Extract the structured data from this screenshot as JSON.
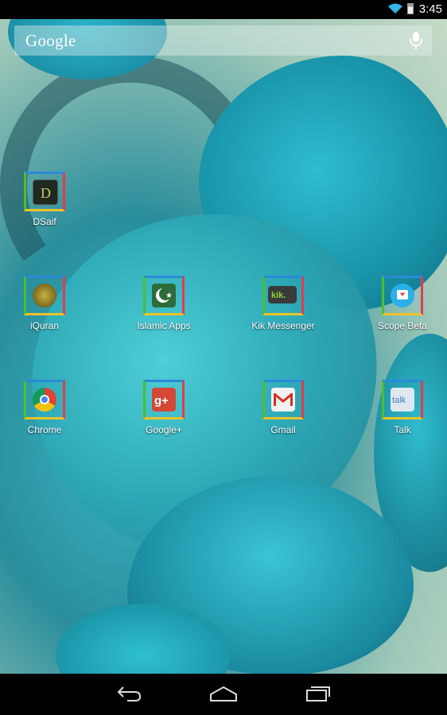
{
  "status_bar": {
    "time": "3:45",
    "icons": [
      "wifi-icon",
      "battery-icon"
    ]
  },
  "search": {
    "logo": "Google",
    "icon": "mic-icon"
  },
  "apps": [
    {
      "label": "DSaif",
      "icon": "dsaif-icon"
    },
    {
      "label": "iQuran",
      "icon": "iquran-icon"
    },
    {
      "label": "Islamic Apps",
      "icon": "islamic-apps-icon"
    },
    {
      "label": "Kik Messenger",
      "icon": "kik-icon"
    },
    {
      "label": "Scope Beta",
      "icon": "scope-icon"
    },
    {
      "label": "Chrome",
      "icon": "chrome-icon"
    },
    {
      "label": "Google+",
      "icon": "google-plus-icon"
    },
    {
      "label": "Gmail",
      "icon": "gmail-icon"
    },
    {
      "label": "Talk",
      "icon": "talk-icon"
    }
  ],
  "nav_bar": {
    "buttons": [
      "back-icon",
      "home-icon",
      "recents-icon"
    ]
  },
  "colors": {
    "frame_top": "#2a8ad8",
    "frame_bottom": "#f0c22a",
    "frame_left": "#4cbf2e",
    "frame_right": "#e63a4a"
  }
}
